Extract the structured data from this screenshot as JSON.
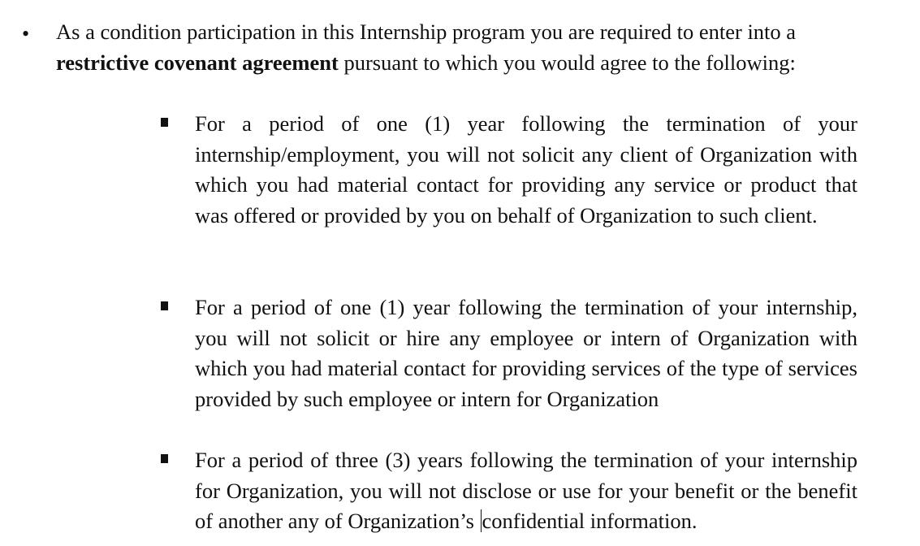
{
  "intro": {
    "bullet": "•",
    "text_before": "As a condition participation in this Internship program you are required to enter into a ",
    "bold": "restrictive covenant agreement",
    "text_after": " pursuant to which you would agree to the following:"
  },
  "items": [
    {
      "text": "For a period of one (1) year following the termination of your internship/employment, you will not solicit any client of Organization with which you had material contact for providing any service or product that was offered or provided by you on behalf of Organization to such client."
    },
    {
      "text": "For a period of one (1) year following the termination of your internship, you will not solicit or hire any employee or intern of Organization with which you had material contact for providing services of the type of services provided by such employee or intern for Organization"
    },
    {
      "text_before_cursor": "For a period of three (3) years following the termination of your internship for Organization, you will not disclose or use for your benefit or the benefit of another any of Organization’s ",
      "text_after_cursor": "confidential information."
    }
  ]
}
